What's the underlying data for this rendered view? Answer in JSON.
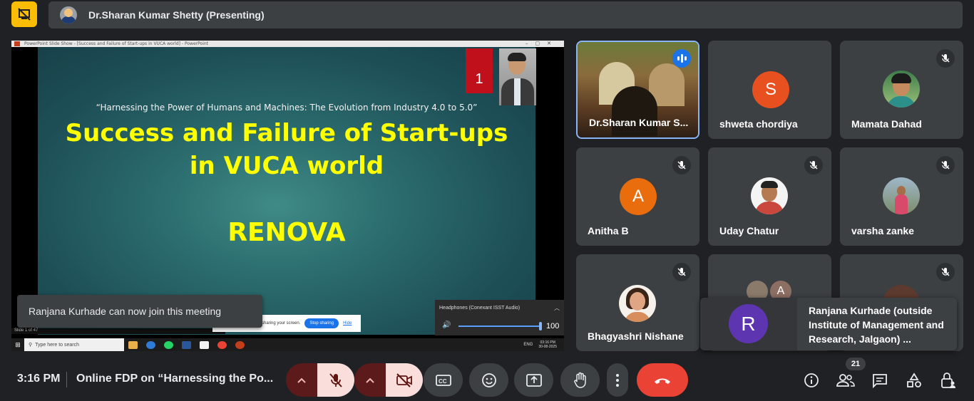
{
  "presenter": {
    "name": "Dr.Sharan Kumar Shetty (Presenting)"
  },
  "screen": {
    "window_title": "PowerPoint Slide Show - [Success and Failure of Start-ups in VUCA world] - PowerPoint",
    "slide_number": "1",
    "subtitle": "“Harnessing the Power of Humans and Machines: The Evolution from Industry 4.0 to 5.0”",
    "title_line1": "Success and Failure of Start-ups",
    "title_line2": "in VUCA world",
    "renova": "RENOVA",
    "status": "Slide 1 of 47",
    "share_text": "sharing your screen.",
    "stop_sharing": "Stop sharing",
    "hide": "Hide",
    "audio_device": "Headphones (Conexant ISST Audio)",
    "volume": "100",
    "taskbar_search": "Type here to search",
    "tray_lang": "ENG",
    "tray_time": "03:16 PM",
    "tray_date": "30-08-2025"
  },
  "toast": {
    "text": "Ranjana Kurhade can now join this meeting"
  },
  "tiles": [
    {
      "name": "Dr.Sharan Kumar S...",
      "type": "video"
    },
    {
      "name": "shweta chordiya",
      "letter": "S",
      "color": "#e8501f"
    },
    {
      "name": "Mamata Dahad",
      "type": "photo"
    },
    {
      "name": "Anitha B",
      "letter": "A",
      "color": "#ea6d0d"
    },
    {
      "name": "Uday Chatur",
      "type": "photo"
    },
    {
      "name": "varsha zanke",
      "type": "photo"
    },
    {
      "name": "Bhagyashri Nishane",
      "type": "photo"
    }
  ],
  "join_popup": {
    "letter": "R",
    "text": "Ranjana Kurhade (outside Institute of Management and Research, Jalgaon) ..."
  },
  "bottom": {
    "time": "3:16 PM",
    "meeting_name": "Online FDP on “Harnessing the Po...",
    "participant_count": "21"
  },
  "colors": {
    "background": "#202124",
    "tile": "#3c4043",
    "accent_blue": "#1a73e8",
    "end_call": "#ea4335",
    "muted_pill": "#f9dedc",
    "slide_title": "#ffff00"
  }
}
